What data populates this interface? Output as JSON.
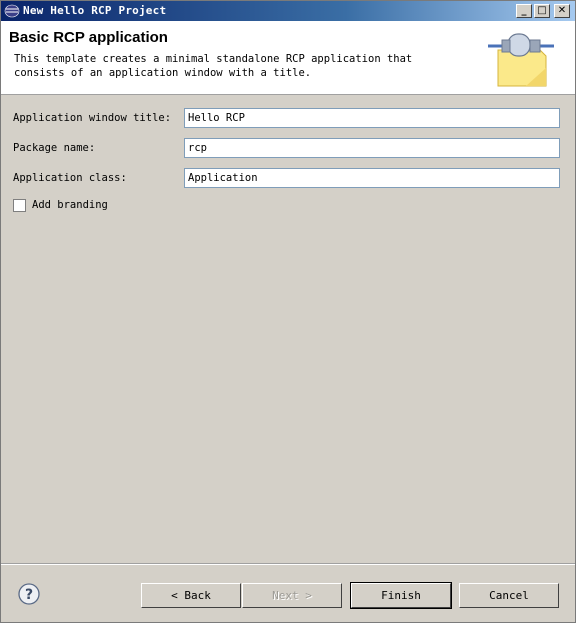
{
  "window": {
    "title": "New Hello RCP Project",
    "controls": [
      "_",
      "□",
      "✕"
    ]
  },
  "header": {
    "title": "Basic RCP application",
    "description": "This template creates a minimal standalone RCP application that consists of an application window with a title."
  },
  "form": {
    "app_window_title": {
      "label": "Application window title:",
      "value": "Hello RCP"
    },
    "package_name": {
      "label": "Package name:",
      "value": "rcp"
    },
    "application_class": {
      "label": "Application class:",
      "value": "Application"
    },
    "add_branding": {
      "label": "Add branding",
      "checked": false
    }
  },
  "buttons": {
    "help_icon": "help-icon",
    "back": "< Back",
    "next": "Next >",
    "finish": "Finish",
    "cancel": "Cancel"
  },
  "colors": {
    "titlebar": "#0a246a",
    "dialog_bg": "#d4d0c8",
    "input_border": "#7f9db9"
  }
}
